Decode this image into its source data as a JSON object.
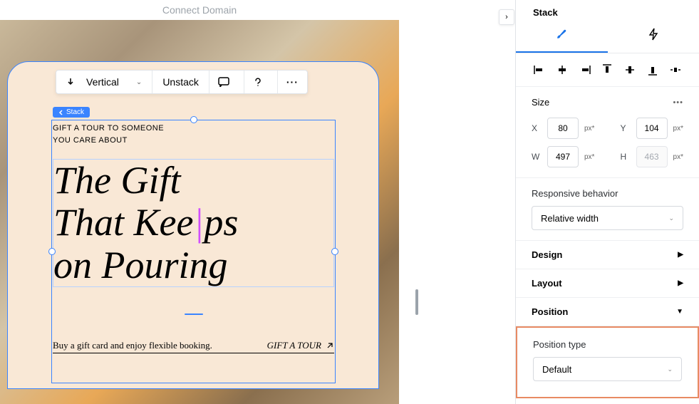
{
  "header": {
    "title": "Connect Domain"
  },
  "canvas": {
    "stack_badge": "Stack",
    "toolbar": {
      "direction": "Vertical",
      "unstack": "Unstack"
    },
    "eyebrow_line1": "GIFT A TOUR TO SOMEONE",
    "eyebrow_line2": "YOU CARE ABOUT",
    "headline_line1": "The Gift",
    "headline_line2_a": "That Kee",
    "headline_line2_b": "ps",
    "headline_line3": "on Pouring",
    "bottom_text": "Buy a gift card and enjoy flexible booking.",
    "gift_link": "GIFT A TOUR"
  },
  "inspector": {
    "title": "Stack",
    "size": {
      "label": "Size",
      "x_label": "X",
      "x_value": "80",
      "x_unit": "px*",
      "y_label": "Y",
      "y_value": "104",
      "y_unit": "px*",
      "w_label": "W",
      "w_value": "497",
      "w_unit": "px*",
      "h_label": "H",
      "h_value": "463",
      "h_unit": "px*"
    },
    "responsive": {
      "label": "Responsive behavior",
      "value": "Relative width"
    },
    "design_label": "Design",
    "layout_label": "Layout",
    "position_label": "Position",
    "position_type": {
      "label": "Position type",
      "value": "Default"
    }
  }
}
